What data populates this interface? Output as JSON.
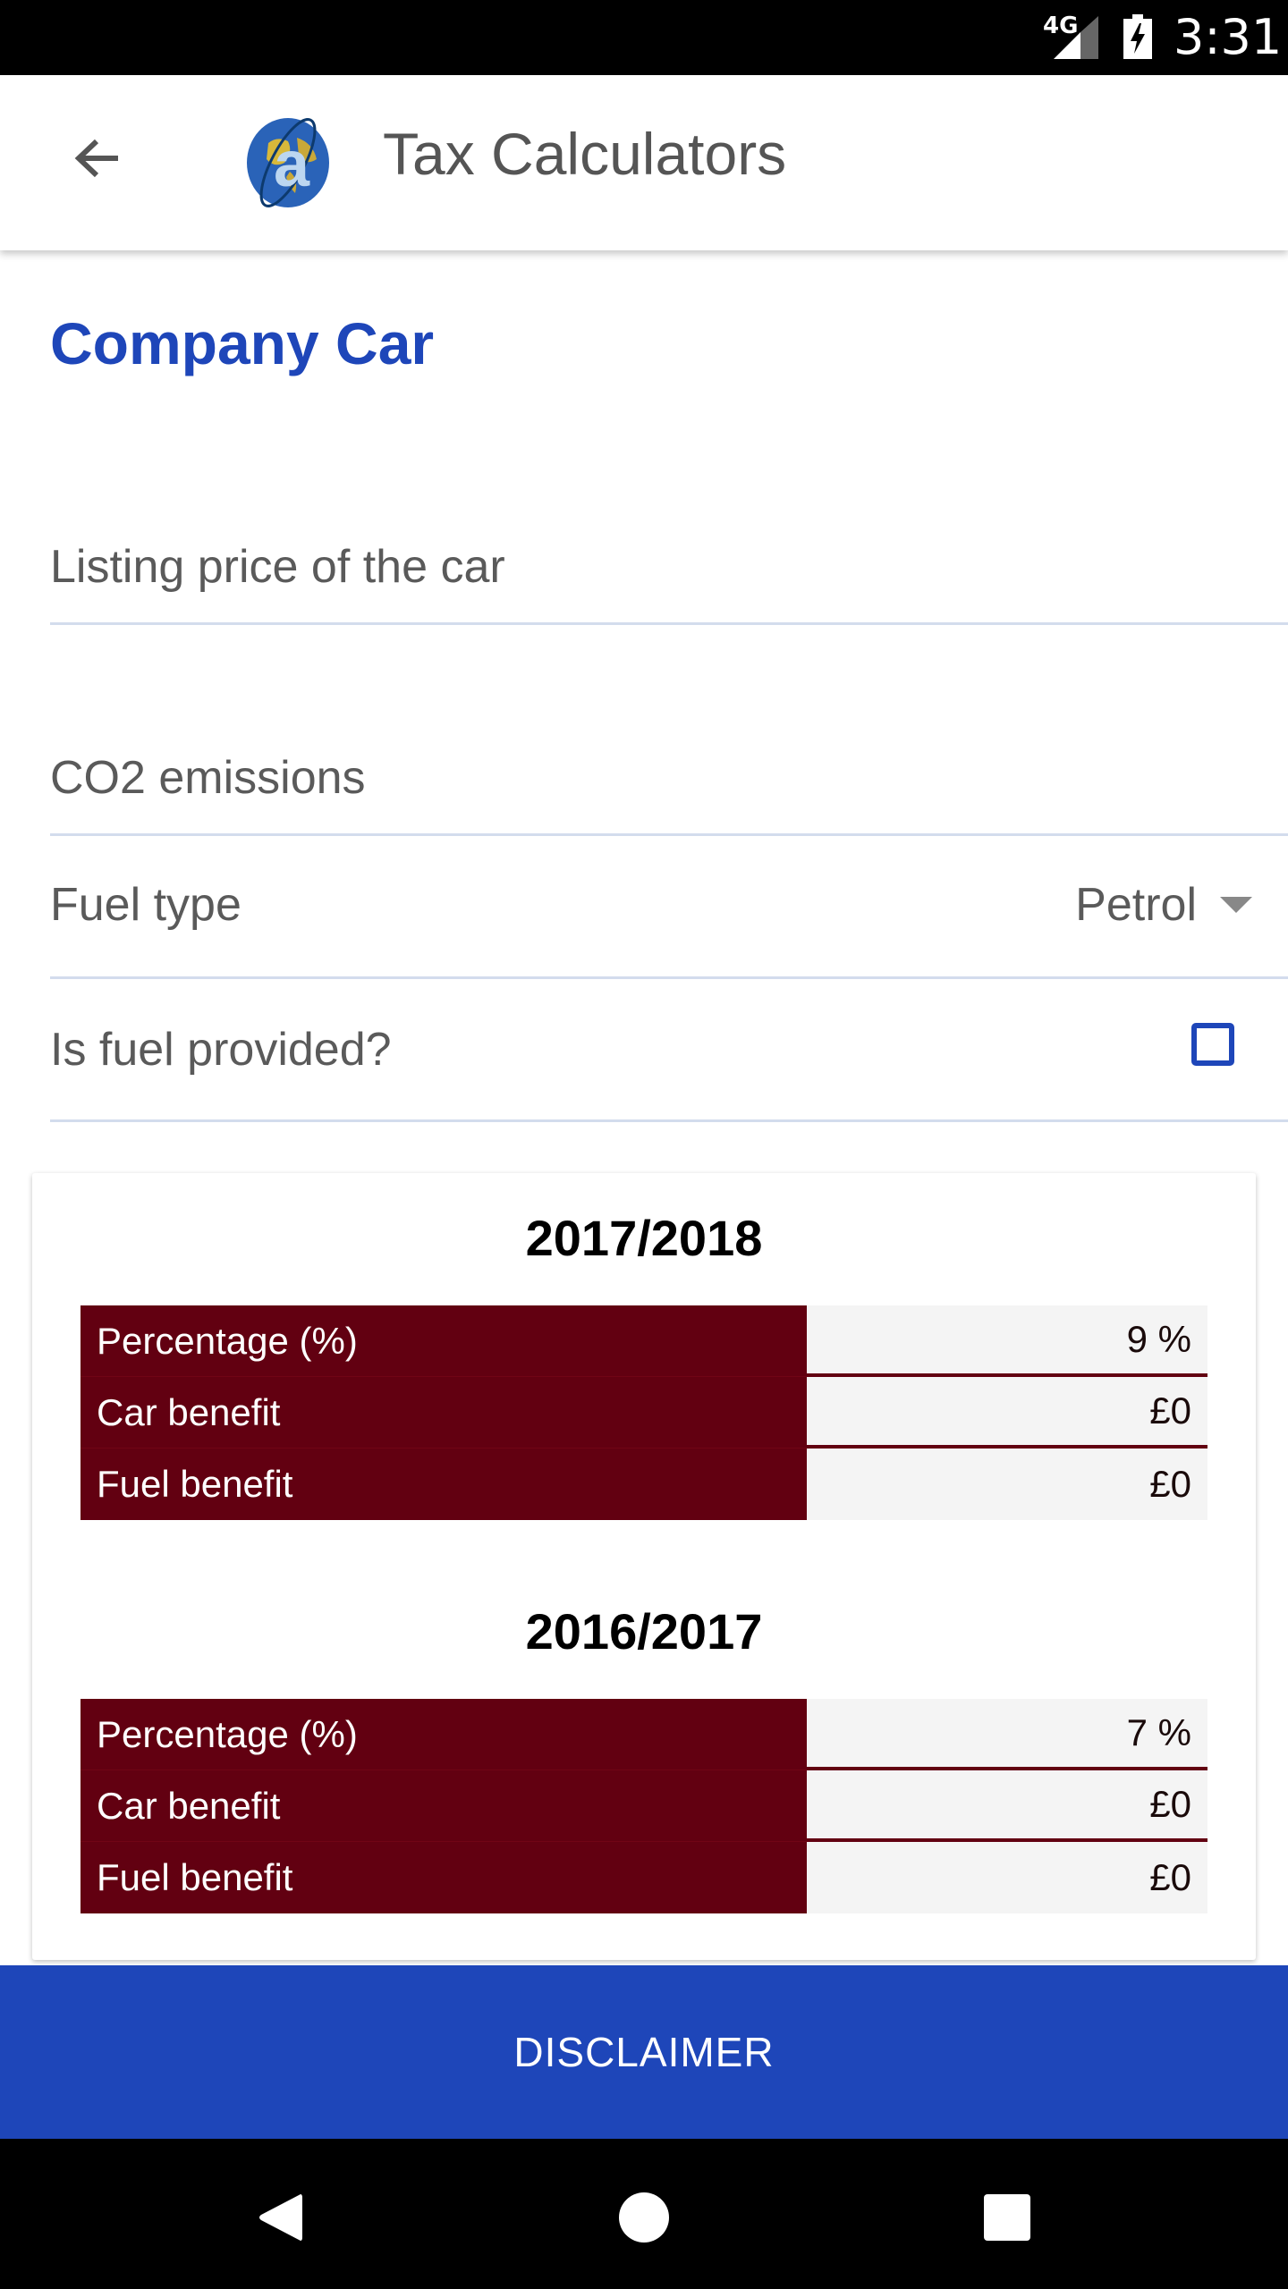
{
  "status_bar": {
    "network": "4G",
    "time": "3:31",
    "icons": [
      "signal-icon",
      "battery-charging-icon"
    ]
  },
  "app_bar": {
    "title": "Tax Calculators",
    "back_icon": "arrow-back-icon",
    "logo_icon": "globe-logo-icon"
  },
  "page": {
    "section_title": "Company Car",
    "fields": {
      "listing_price": {
        "placeholder": "Listing price of the car",
        "value": ""
      },
      "co2": {
        "placeholder": "CO2 emissions",
        "value": ""
      },
      "fuel_type": {
        "label": "Fuel type",
        "selected": "Petrol"
      },
      "fuel_provided": {
        "label": "Is fuel provided?",
        "checked": false
      }
    }
  },
  "results": [
    {
      "year": "2017/2018",
      "rows": [
        {
          "label": "Percentage (%)",
          "value": "9 %"
        },
        {
          "label": "Car benefit",
          "value": "£0"
        },
        {
          "label": "Fuel benefit",
          "value": "£0"
        }
      ]
    },
    {
      "year": "2016/2017",
      "rows": [
        {
          "label": "Percentage (%)",
          "value": "7 %"
        },
        {
          "label": "Car benefit",
          "value": "£0"
        },
        {
          "label": "Fuel benefit",
          "value": "£0"
        }
      ]
    }
  ],
  "footer": {
    "disclaimer_label": "DISCLAIMER"
  },
  "nav_bar": {
    "icons": [
      "nav-back-icon",
      "nav-home-icon",
      "nav-recents-icon"
    ]
  },
  "colors": {
    "accent": "#1e46b9",
    "table_label_bg": "#620011",
    "table_value_bg": "#f4f4f4",
    "field_underline": "#d3dced"
  }
}
